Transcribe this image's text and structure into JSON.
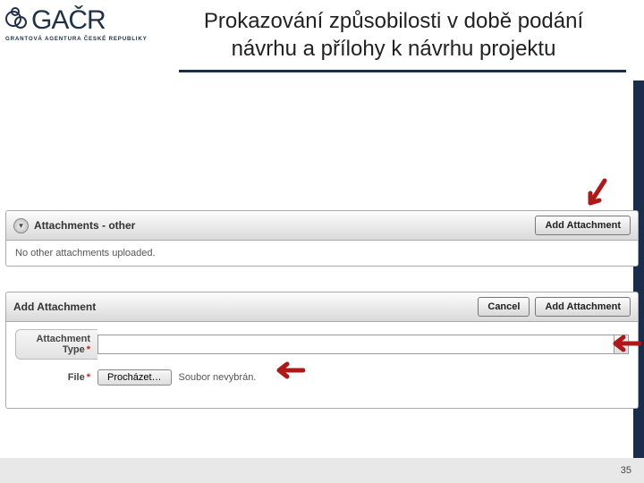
{
  "logo": {
    "text": "GAČR",
    "subtitle": "GRANTOVÁ AGENTURA ČESKÉ REPUBLIKY"
  },
  "title": "Prokazování způsobilosti v době podání návrhu a přílohy k návrhu projektu",
  "panel1": {
    "label": "Attachments - other",
    "add_btn": "Add Attachment",
    "empty_msg": "No other attachments uploaded."
  },
  "panel2": {
    "label": "Add Attachment",
    "cancel_btn": "Cancel",
    "add_btn": "Add Attachment",
    "form": {
      "type_label": "Attachment Type",
      "type_value": "",
      "file_label": "File",
      "browse_btn": "Procházet…",
      "file_status": "Soubor nevybrán."
    }
  },
  "footer": {
    "page_number": "35"
  }
}
